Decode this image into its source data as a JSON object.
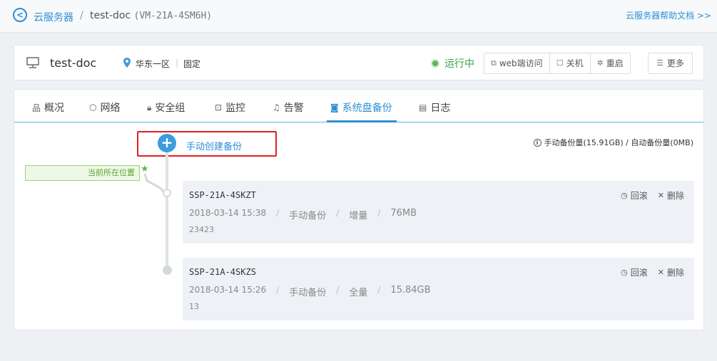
{
  "breadcrumb": {
    "root": "云服务器",
    "separator": "/",
    "current_name": "test-doc",
    "current_id": "(VM-21A-4SM6H)",
    "help_link": "云服务器帮助文档 >>"
  },
  "instance": {
    "name": "test-doc",
    "region": "华东一区",
    "region_sep": "|",
    "ip_type": "固定",
    "status": "运行中",
    "status_color": "#5cb85c",
    "actions": {
      "web_console": "web端访问",
      "shutdown": "关机",
      "restart": "重启",
      "more": "更多"
    }
  },
  "tabs": [
    {
      "label": "概况",
      "icon": "overview-icon"
    },
    {
      "label": "网络",
      "icon": "network-icon"
    },
    {
      "label": "安全组",
      "icon": "lock-icon"
    },
    {
      "label": "监控",
      "icon": "monitor-chart-icon"
    },
    {
      "label": "告警",
      "icon": "bell-icon"
    },
    {
      "label": "系统盘备份",
      "icon": "camera-icon",
      "active": true
    },
    {
      "label": "日志",
      "icon": "log-icon"
    }
  ],
  "backup": {
    "create_label": "手动创建备份",
    "quota_text": "手动备份量(15.91GB) / 自动备份量(0MB)",
    "current_position": "当前所在位置",
    "snapshots": [
      {
        "name": "SSP-21A-4SKZT",
        "time": "2018-03-14 15:38",
        "kind": "手动备份",
        "mode": "增量",
        "size": "76MB",
        "desc": "23423",
        "rollback": "回滚",
        "delete": "删除"
      },
      {
        "name": "SSP-21A-4SKZS",
        "time": "2018-03-14 15:26",
        "kind": "手动备份",
        "mode": "全量",
        "size": "15.84GB",
        "desc": "13",
        "rollback": "回滚",
        "delete": "删除"
      }
    ]
  },
  "colors": {
    "accent": "#2d8fd5",
    "highlight_border": "#e02020",
    "current_tag_green": "#5aa52f"
  }
}
